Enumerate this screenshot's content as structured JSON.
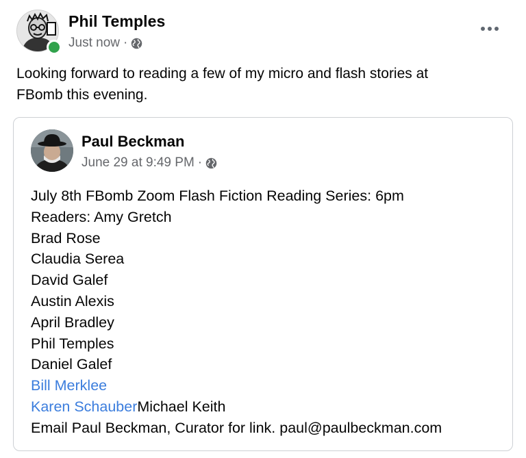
{
  "post": {
    "author": "Phil Temples",
    "timestamp": "Just now",
    "separator": "·",
    "privacy_icon": "globe-icon",
    "more_icon": "more-options-icon",
    "online_status_color": "#31a24c",
    "text": "Looking forward to reading a few of my micro and flash stories at\nFBomb this evening."
  },
  "shared_post": {
    "author": "Paul Beckman",
    "timestamp": "June 29 at 9:49 PM",
    "separator": "·",
    "privacy_icon": "globe-icon",
    "lines": [
      "July 8th FBomb Zoom Flash Fiction Reading Series: 6pm",
      "Readers: Amy Gretch",
      "Brad Rose",
      "Claudia Serea",
      "David Galef",
      "Austin Alexis",
      "April Bradley",
      "Phil Temples",
      "Daniel Galef"
    ],
    "link_bill": "Bill Merklee",
    "link_karen": "Karen Schauber",
    "after_karen": "Michael Keith",
    "email_line": "Email Paul Beckman, Curator for link. paul@paulbeckman.com"
  },
  "colors": {
    "link": "#3b7ddd",
    "secondary_text": "#65676b",
    "border": "#cdd0d4"
  }
}
